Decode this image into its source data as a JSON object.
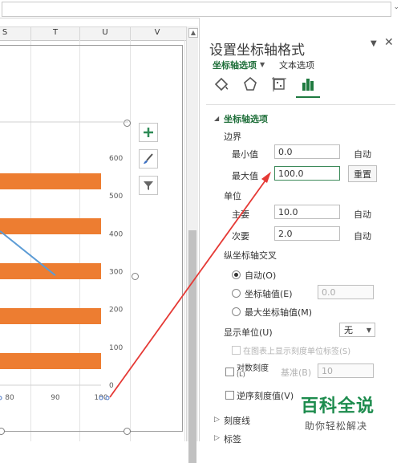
{
  "spreadsheet": {
    "columns": [
      "S",
      "T",
      "U",
      "V"
    ]
  },
  "chart": {
    "colors": {
      "bar": "#ed7d31",
      "line": "#5b9bd5"
    },
    "y_ticks": [
      "600",
      "500",
      "400",
      "300",
      "200",
      "100",
      "0"
    ],
    "x_ticks": [
      "80",
      "90",
      "100"
    ],
    "buttons": {
      "add": "chart-elements-icon",
      "style": "chart-styles-icon",
      "filter": "chart-filters-icon"
    }
  },
  "chart_data": {
    "type": "bar",
    "orientation": "horizontal",
    "x_axis_ticks": [
      80,
      90,
      100
    ],
    "secondary_y_ticks": [
      0,
      100,
      200,
      300,
      400,
      500,
      600
    ],
    "bars_visible": 5,
    "line_series_visible_points": [
      {
        "x": 90,
        "y": 290
      }
    ],
    "xlim": [
      0,
      100
    ],
    "ylim": [
      0,
      600
    ]
  },
  "panel": {
    "title": "设置坐标轴格式",
    "tab_axis_options": "坐标轴选项",
    "tab_text_options": "文本选项",
    "icon_tabs": [
      "fill-line-icon",
      "effects-icon",
      "size-properties-icon",
      "axis-options-icon"
    ],
    "section_axis_options": "坐标轴选项",
    "bounds_label": "边界",
    "min_label": "最小值",
    "min_value": "0.0",
    "min_auto": "自动",
    "max_label": "最大值",
    "max_value": "100.0",
    "max_reset": "重置",
    "units_label": "单位",
    "major_label": "主要",
    "major_value": "10.0",
    "major_auto": "自动",
    "minor_label": "次要",
    "minor_value": "2.0",
    "minor_auto": "自动",
    "vertical_cross_label": "纵坐标轴交叉",
    "cross_auto": "自动(O)",
    "cross_value": "坐标轴值(E)",
    "cross_value_input": "0.0",
    "cross_max": "最大坐标轴值(M)",
    "display_units_label": "显示单位(U)",
    "display_units_value": "无",
    "show_units_label": "在图表上显示刻度单位标签(S)",
    "log_scale_label": "对数刻度",
    "log_scale_sub": "(L)",
    "base_label": "基准(B)",
    "base_value": "10",
    "reverse_label": "逆序刻度值(V)",
    "tick_marks_section": "刻度线",
    "labels_section": "标签"
  },
  "watermark": {
    "title": "百科全说",
    "subtitle": "助你轻松解决"
  }
}
